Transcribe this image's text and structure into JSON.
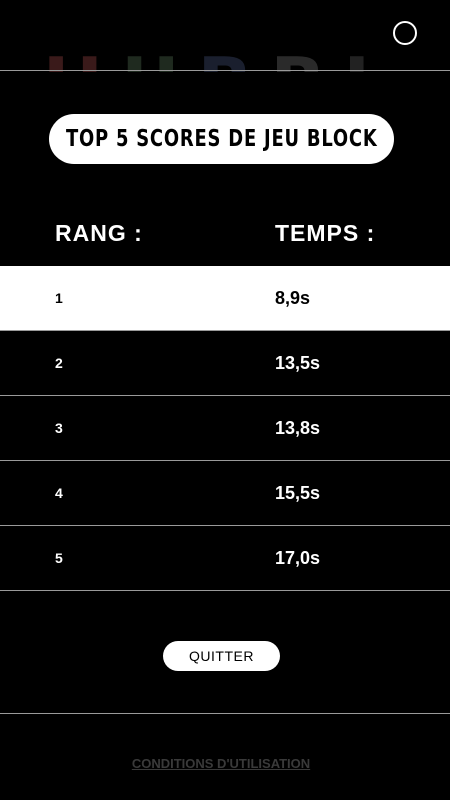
{
  "background": {
    "watermark_letters": [
      "H",
      "U",
      "B",
      "B",
      "L"
    ]
  },
  "header": {
    "close_icon": "circle-close-icon"
  },
  "scoreboard": {
    "title": "TOP 5 SCORES DE JEU BLOCK",
    "headers": {
      "rank": "RANG :",
      "time": "TEMPS :"
    },
    "rows": [
      {
        "rank": "1",
        "time": "8,9s",
        "highlighted": true
      },
      {
        "rank": "2",
        "time": "13,5s",
        "highlighted": false
      },
      {
        "rank": "3",
        "time": "13,8s",
        "highlighted": false
      },
      {
        "rank": "4",
        "time": "15,5s",
        "highlighted": false
      },
      {
        "rank": "5",
        "time": "17,0s",
        "highlighted": false
      }
    ]
  },
  "actions": {
    "quit_label": "QUITTER"
  },
  "footer": {
    "terms_label": "CONDITIONS D'UTILISATION"
  },
  "colors": {
    "background": "#000000",
    "highlight_row": "#ffffff",
    "divider": "#9a9a9a",
    "footer_link": "#3a3a3a"
  }
}
